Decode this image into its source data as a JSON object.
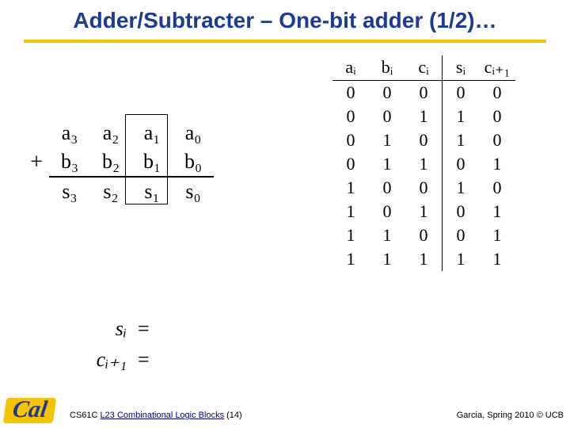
{
  "title": "Adder/Subtracter – One-bit adder (1/2)…",
  "addition": {
    "plus": "+",
    "a": [
      "a₃",
      "a₂",
      "a₁",
      "a₀"
    ],
    "b": [
      "b₃",
      "b₂",
      "b₁",
      "b₀"
    ],
    "s": [
      "s₃",
      "s₂",
      "s₁",
      "s₀"
    ]
  },
  "truth_table": {
    "headers": [
      "aᵢ",
      "bᵢ",
      "cᵢ",
      "sᵢ",
      "cᵢ₊₁"
    ],
    "rows": [
      [
        "0",
        "0",
        "0",
        "0",
        "0"
      ],
      [
        "0",
        "0",
        "1",
        "1",
        "0"
      ],
      [
        "0",
        "1",
        "0",
        "1",
        "0"
      ],
      [
        "0",
        "1",
        "1",
        "0",
        "1"
      ],
      [
        "1",
        "0",
        "0",
        "1",
        "0"
      ],
      [
        "1",
        "0",
        "1",
        "0",
        "1"
      ],
      [
        "1",
        "1",
        "0",
        "0",
        "1"
      ],
      [
        "1",
        "1",
        "1",
        "1",
        "1"
      ]
    ]
  },
  "equations": {
    "s_lhs": "sᵢ",
    "c_lhs": "cᵢ₊₁",
    "eq": "="
  },
  "footer": {
    "logo": "Cal",
    "left_plain": "CS61C ",
    "left_ul": "L23 Combinational Logic Blocks",
    "left_after": " (14)",
    "right": "Garcia, Spring 2010 © UCB"
  },
  "chart_data": {
    "type": "table",
    "title": "One-bit full adder truth table",
    "columns": [
      "a_i",
      "b_i",
      "c_i",
      "s_i",
      "c_{i+1}"
    ],
    "rows": [
      [
        0,
        0,
        0,
        0,
        0
      ],
      [
        0,
        0,
        1,
        1,
        0
      ],
      [
        0,
        1,
        0,
        1,
        0
      ],
      [
        0,
        1,
        1,
        0,
        1
      ],
      [
        1,
        0,
        0,
        1,
        0
      ],
      [
        1,
        0,
        1,
        0,
        1
      ],
      [
        1,
        1,
        0,
        0,
        1
      ],
      [
        1,
        1,
        1,
        1,
        1
      ]
    ]
  }
}
